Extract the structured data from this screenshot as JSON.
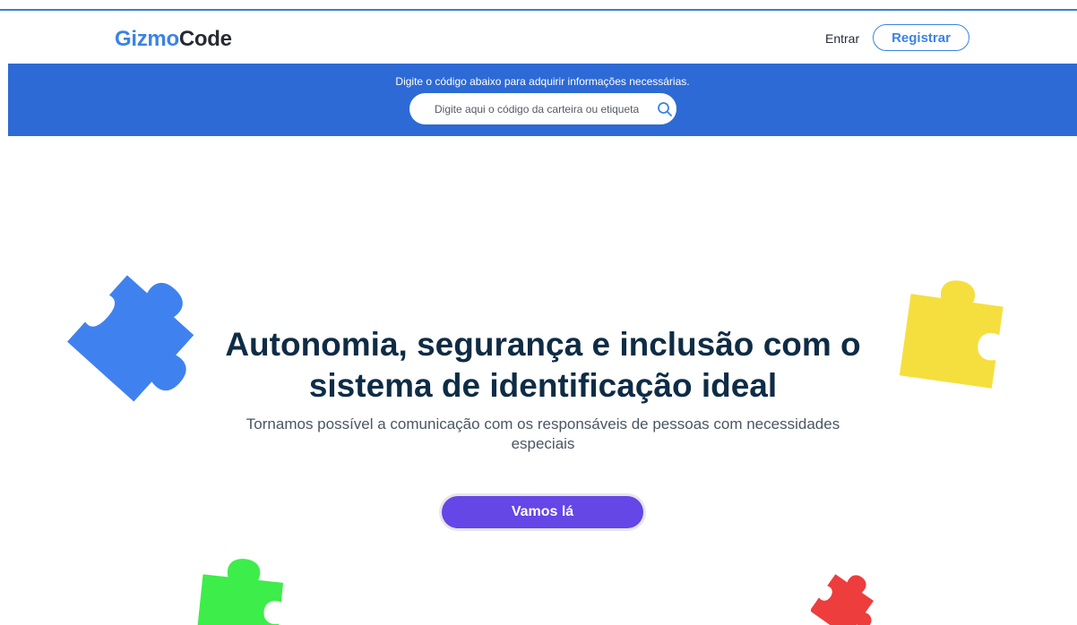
{
  "header": {
    "logo_part1": "Gizmo",
    "logo_part2": "Code",
    "signin_label": "Entrar",
    "register_label": "Registrar"
  },
  "banner": {
    "text": "Digite o código abaixo para adquirir informações necessárias.",
    "search_placeholder": "Digite aqui o código da carteira ou etiqueta",
    "search_value": "",
    "search_icon": "search-icon"
  },
  "hero": {
    "title": "Autonomia, segurança e inclusão com o sistema de identificação ideal",
    "subtitle": "Tornamos possível a comunicação com os responsáveis de pessoas com necessidades especiais",
    "cta_label": "Vamos lá"
  },
  "decorations": [
    {
      "name": "puzzle-piece-blue",
      "color": "#3f82ef"
    },
    {
      "name": "puzzle-piece-yellow",
      "color": "#f5df3f"
    },
    {
      "name": "puzzle-piece-green",
      "color": "#3ded4a"
    },
    {
      "name": "puzzle-piece-red",
      "color": "#ee3d3d"
    }
  ],
  "colors": {
    "brand_blue": "#3b82e6",
    "banner_blue": "#2d6ad5",
    "title_dark": "#0f2c45",
    "cta_purple": "#6546e6"
  }
}
